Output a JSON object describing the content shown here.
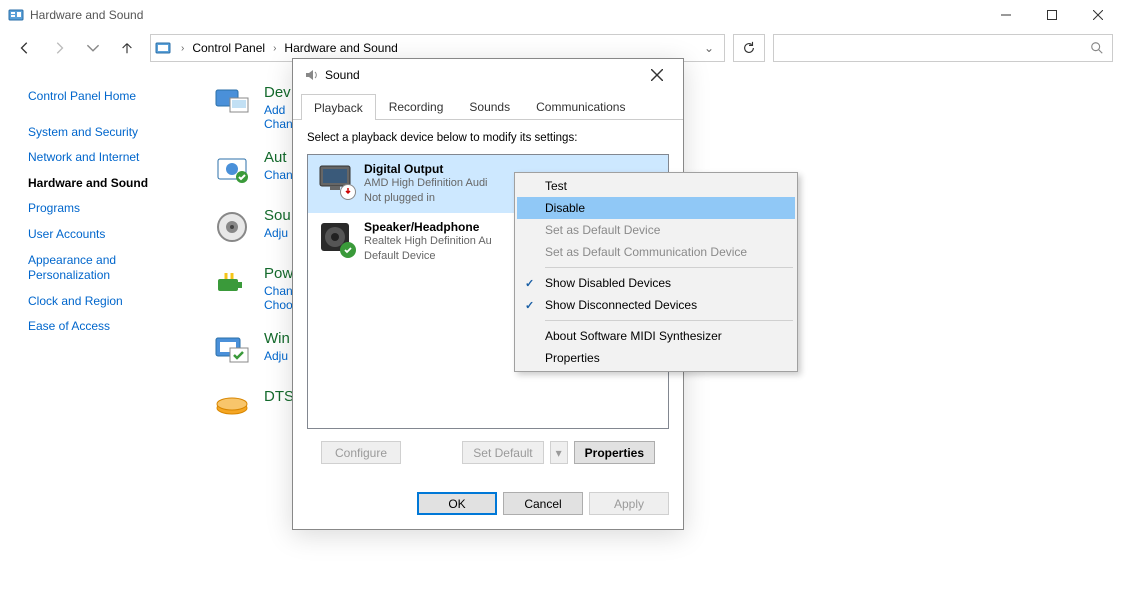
{
  "window": {
    "title": "Hardware and Sound"
  },
  "breadcrumb": {
    "items": [
      "Control Panel",
      "Hardware and Sound"
    ]
  },
  "sidebar": {
    "links": [
      {
        "label": "Control Panel Home",
        "current": false
      },
      {
        "label": "System and Security",
        "current": false
      },
      {
        "label": "Network and Internet",
        "current": false
      },
      {
        "label": "Hardware and Sound",
        "current": true
      },
      {
        "label": "Programs",
        "current": false
      },
      {
        "label": "User Accounts",
        "current": false
      },
      {
        "label": "Appearance and Personalization",
        "current": false
      },
      {
        "label": "Clock and Region",
        "current": false
      },
      {
        "label": "Ease of Access",
        "current": false
      }
    ]
  },
  "categories": [
    {
      "title": "Dev",
      "links": "Add\nChan"
    },
    {
      "title": "Aut",
      "links": "Chan"
    },
    {
      "title": "Sou",
      "links": "Adju"
    },
    {
      "title": "Pow",
      "links": "Chan\nChoo"
    },
    {
      "title": "Win",
      "links": "Adju"
    },
    {
      "title": "DTS",
      "links": ""
    }
  ],
  "dialog": {
    "title": "Sound",
    "tabs": [
      "Playback",
      "Recording",
      "Sounds",
      "Communications"
    ],
    "active_tab": 0,
    "hint": "Select a playback device below to modify its settings:",
    "devices": [
      {
        "name": "Digital Output",
        "driver": "AMD High Definition Audi",
        "status": "Not plugged in",
        "selected": true,
        "overlay": "unplugged"
      },
      {
        "name": "Speaker/Headphone",
        "driver": "Realtek High Definition Au",
        "status": "Default Device",
        "selected": false,
        "overlay": "default"
      }
    ],
    "buttons": {
      "configure": "Configure",
      "set_default": "Set Default",
      "properties": "Properties",
      "ok": "OK",
      "cancel": "Cancel",
      "apply": "Apply"
    }
  },
  "context_menu": {
    "items": [
      {
        "label": "Test",
        "state": "normal"
      },
      {
        "label": "Disable",
        "state": "highlight"
      },
      {
        "label": "Set as Default Device",
        "state": "disabled"
      },
      {
        "label": "Set as Default Communication Device",
        "state": "disabled"
      },
      {
        "sep": true
      },
      {
        "label": "Show Disabled Devices",
        "state": "checked"
      },
      {
        "label": "Show Disconnected Devices",
        "state": "checked"
      },
      {
        "sep": true
      },
      {
        "label": "About Software MIDI Synthesizer",
        "state": "normal"
      },
      {
        "label": "Properties",
        "state": "normal"
      }
    ]
  }
}
